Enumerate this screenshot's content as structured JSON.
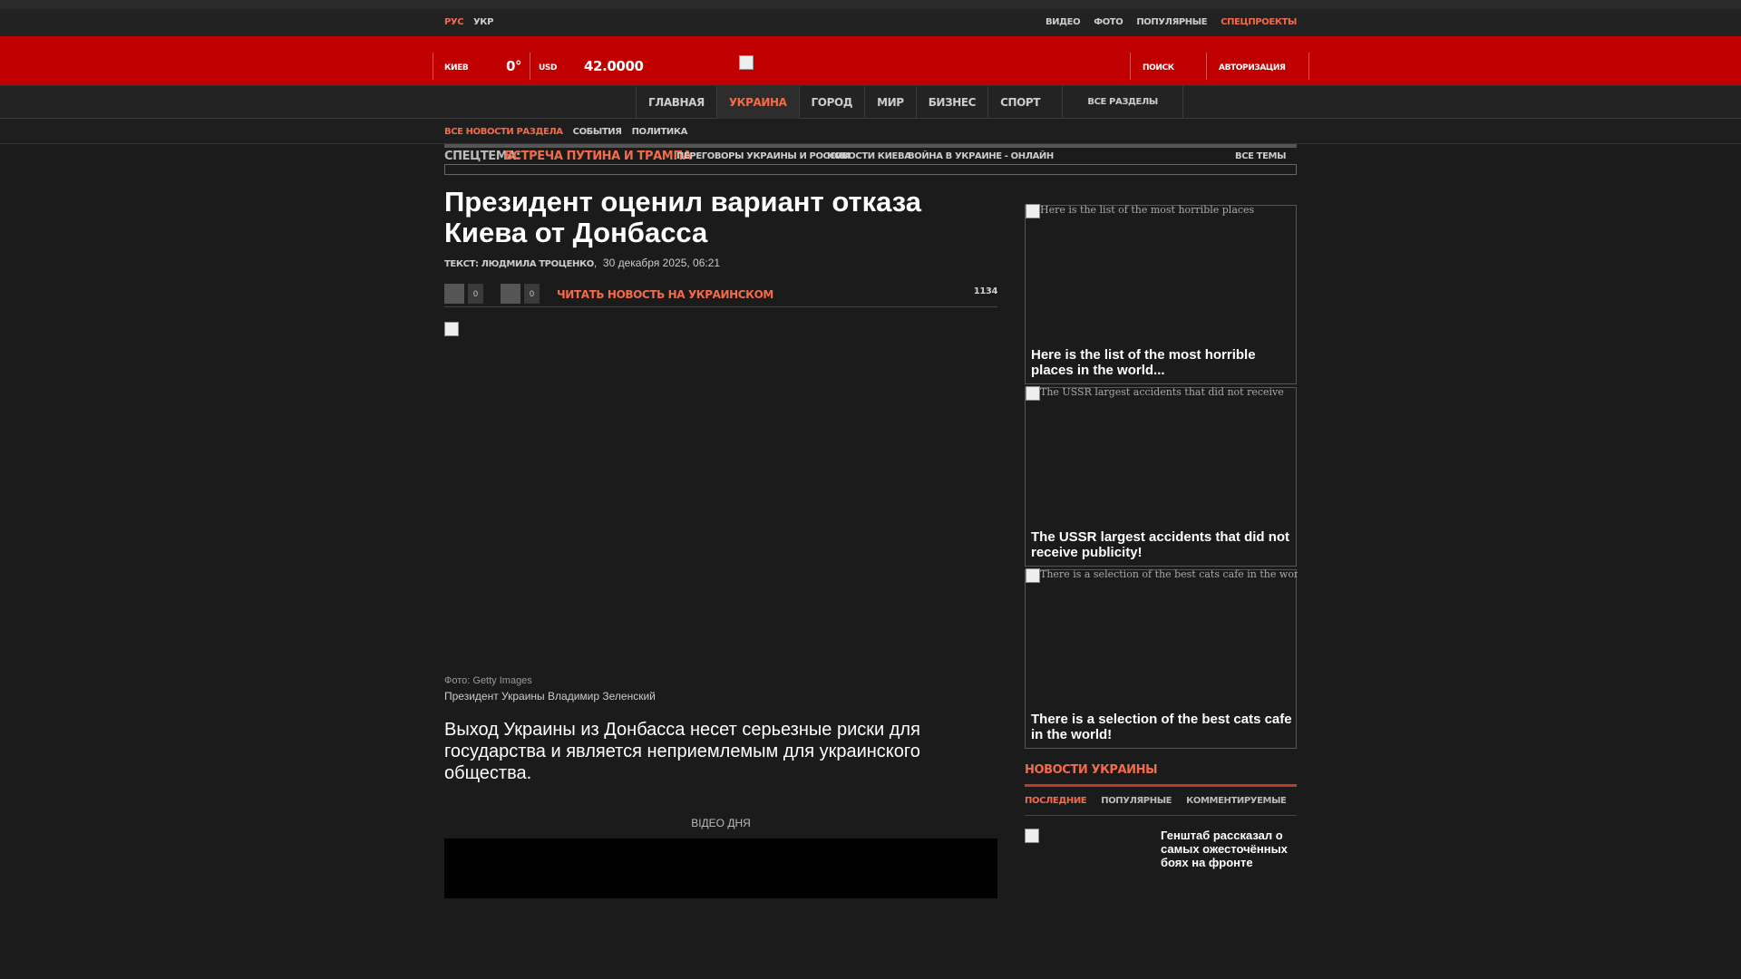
{
  "topbar": {
    "lang_ru": "РУС",
    "lang_uk": "УКР",
    "links": [
      "ВИДЕО",
      "ФОТО",
      "ПОПУЛЯРНЫЕ",
      "СПЕЦПРОЕКТЫ"
    ]
  },
  "header": {
    "city": "КИЕВ",
    "temperature": "0°",
    "currency_label": "USD",
    "currency_value": "42.0000",
    "search": "ПОИСК",
    "auth": "АВТОРИЗАЦИЯ"
  },
  "nav": {
    "items": [
      "ГЛАВНАЯ",
      "УКРАИНА",
      "ГОРОД",
      "МИР",
      "БИЗНЕС",
      "СПОРТ"
    ],
    "all_sections": "ВСЕ РАЗДЕЛЫ"
  },
  "subnav": {
    "items": [
      "ВСЕ НОВОСТИ РАЗДЕЛА",
      "СОБЫТИЯ",
      "ПОЛИТИКА"
    ]
  },
  "spec": {
    "label": "СПЕЦТЕМА:",
    "topic": "ВСТРЕЧА ПУТИНА И ТРАМПА",
    "tags": [
      "ПЕРЕГОВОРЫ УКРАИНЫ И РОССИИ",
      "НОВОСТИ КИЕВА",
      "ВОЙНА В УКРАИНЕ - ОНЛАЙН"
    ],
    "all_topics": "ВСЕ ТЕМЫ"
  },
  "article": {
    "title": "Президент оценил вариант отказа Киева от Донбасса",
    "author": "ТЕКСТ: ЛЮДМИЛА  ТРОЦЕНКО",
    "date": "30 декабря 2025, 06:21",
    "share_count_1": "0",
    "share_count_2": "0",
    "read_ukr": "ЧИТАТЬ НОВОСТЬ НА УКРАИНСКОМ",
    "views": "1134",
    "photo_credit": "Фото: Getty Images",
    "photo_caption": "Президент Украины Владимир Зеленский",
    "lead": "Выход Украины из Донбасса несет серьезные риски для государства и является неприемлемым для украинского общества.",
    "video_label": "ВІДЕО ДНЯ"
  },
  "sidebar": {
    "cards": [
      {
        "alt": "Here is the list of the most horrible places",
        "title": "Here is the list of the most horrible places in the world..."
      },
      {
        "alt": "The USSR largest accidents that did not receive",
        "title": "The USSR largest accidents that did not receive publicity!"
      },
      {
        "alt": "There is a selection of the best cats cafe in the world!",
        "title": "There is a selection of the best cats cafe in the world!"
      }
    ],
    "news_header": "НОВОСТИ УКРАИНЫ",
    "tabs": [
      "ПОСЛЕДНИЕ",
      "ПОПУЛЯРНЫЕ",
      "КОММЕНТИРУЕМЫЕ"
    ],
    "news_item": "Генштаб рассказал о самых ожесточённых боях на фронте"
  },
  "colors": {
    "accent": "#f26b4a",
    "header_red": "#c00000"
  }
}
